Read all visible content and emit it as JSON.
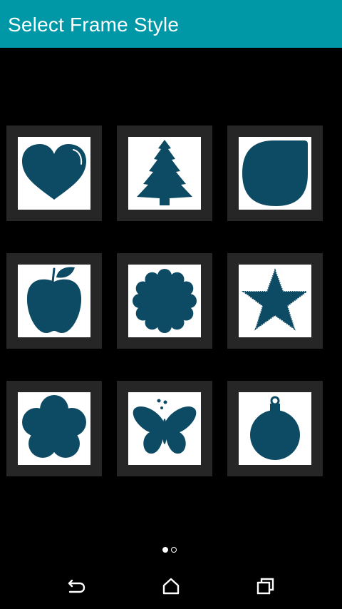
{
  "appbar": {
    "title": "Select Frame Style",
    "color": "#0097a7"
  },
  "frames": [
    {
      "name": "heart",
      "icon": "heart-icon"
    },
    {
      "name": "tree",
      "icon": "christmas-tree-icon"
    },
    {
      "name": "drop",
      "icon": "drop-corner-icon"
    },
    {
      "name": "apple",
      "icon": "apple-icon"
    },
    {
      "name": "flower-sun",
      "icon": "scalloped-flower-icon"
    },
    {
      "name": "star",
      "icon": "star-icon"
    },
    {
      "name": "flower",
      "icon": "flower-icon"
    },
    {
      "name": "butterfly",
      "icon": "butterfly-icon"
    },
    {
      "name": "ornament",
      "icon": "ornament-ball-icon"
    }
  ],
  "shape_color": "#0d4a63",
  "pager": {
    "pages": 2,
    "current": 1
  },
  "navbar": {
    "back": "back-icon",
    "home": "home-icon",
    "recents": "recents-icon"
  }
}
